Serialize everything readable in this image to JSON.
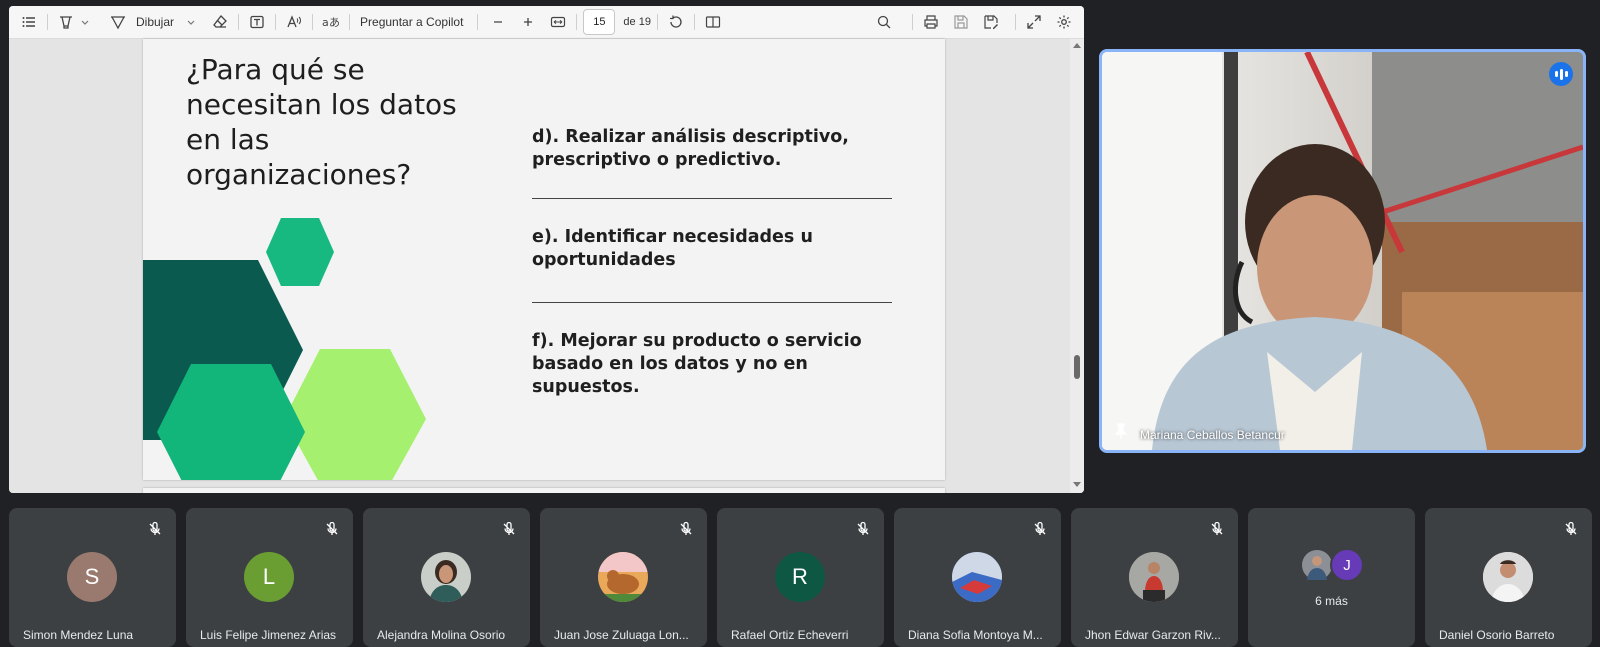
{
  "toolbar": {
    "draw_label": "Dibujar",
    "copilot_label": "Preguntar a Copilot",
    "page_current": "15",
    "page_total": "de 19"
  },
  "slide": {
    "title": "¿Para qué se necesitan los datos en las organizaciones?",
    "items": [
      "d). Realizar análisis descriptivo, prescriptivo o predictivo.",
      "e). Identificar necesidades u oportunidades",
      "f). Mejorar su producto o servicio basado en los datos y no en supuestos."
    ],
    "colors": {
      "dark_green": "#0b5a4f",
      "mid_green": "#12b57a",
      "light_green": "#a5f06e",
      "top_hex": "#17b980"
    }
  },
  "speaker": {
    "name": "Mariana Ceballos Betancur"
  },
  "participants": [
    {
      "name": "Simon Mendez Luna",
      "initial": "S",
      "color": "#9a7a6e",
      "avatar": "letter"
    },
    {
      "name": "Luis Felipe Jimenez Arias",
      "initial": "L",
      "color": "#6a9e33",
      "avatar": "letter"
    },
    {
      "name": "Alejandra Molina Osorio",
      "initial": "",
      "color": "#c9cfc8",
      "avatar": "photo"
    },
    {
      "name": "Juan Jose Zuluaga Lon...",
      "initial": "",
      "color": "#e9a85a",
      "avatar": "photo"
    },
    {
      "name": "Rafael Ortiz Echeverri",
      "initial": "R",
      "color": "#0d5743",
      "avatar": "letter"
    },
    {
      "name": "Diana Sofia Montoya M...",
      "initial": "",
      "color": "#3b6bc4",
      "avatar": "photo"
    },
    {
      "name": "Jhon Edwar Garzon Riv...",
      "initial": "",
      "color": "#8e8f8a",
      "avatar": "photo"
    },
    {
      "name": "Daniel Osorio Barreto",
      "initial": "",
      "color": "#e6e6e6",
      "avatar": "photo"
    }
  ],
  "more": {
    "label": "6 más",
    "second_initial": "J",
    "second_color": "#673ab7"
  }
}
